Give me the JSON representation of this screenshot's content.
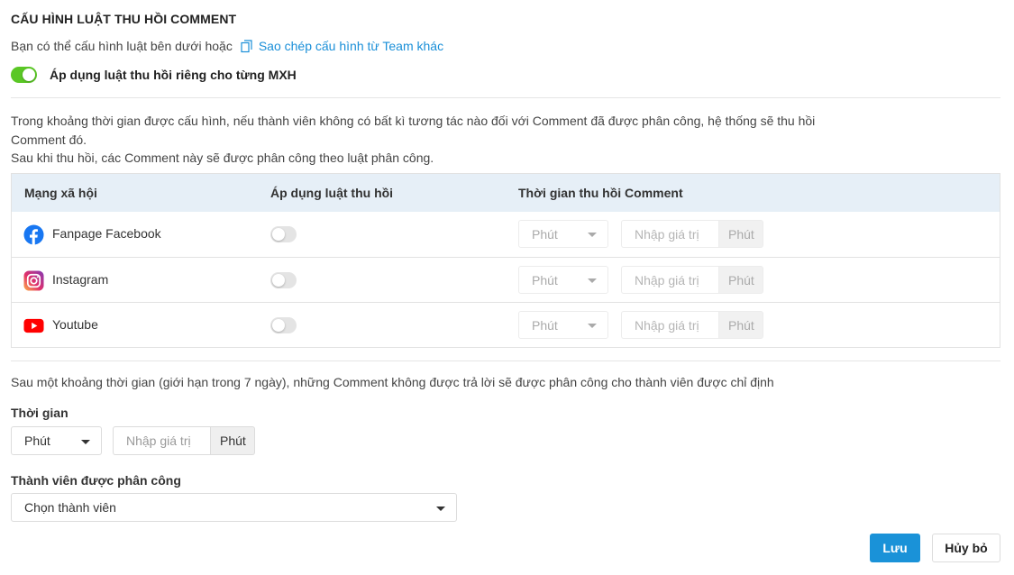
{
  "header": {
    "title": "CẤU HÌNH LUẬT THU HỒI COMMENT",
    "intro_text": "Bạn có thể cấu hình luật bên dưới hoặc",
    "copy_link": "Sao chép cấu hình từ Team khác",
    "copy_icon": "copy-icon"
  },
  "apply_per_network": {
    "label": "Áp dụng luật thu hồi riêng cho từng MXH",
    "enabled": true,
    "accent_color": "#5ac725"
  },
  "description": {
    "line1": "Trong khoảng thời gian được cấu hình, nếu thành viên không có bất kì tương tác nào đối với Comment đã được phân công, hệ thống sẽ thu hồi Comment đó.",
    "line2": "Sau khi thu hồi, các Comment này sẽ được phân công theo luật phân công."
  },
  "table": {
    "columns": [
      "Mạng xã hội",
      "Áp dụng luật thu hồi",
      "Thời gian thu hồi Comment"
    ],
    "rows": [
      {
        "network": "Fanpage Facebook",
        "icon": "facebook-icon",
        "enabled": false,
        "unit": "Phút",
        "placeholder": "Nhập giá trị",
        "addon": "Phút"
      },
      {
        "network": "Instagram",
        "icon": "instagram-icon",
        "enabled": false,
        "unit": "Phút",
        "placeholder": "Nhập giá trị",
        "addon": "Phút"
      },
      {
        "network": "Youtube",
        "icon": "youtube-icon",
        "enabled": false,
        "unit": "Phút",
        "placeholder": "Nhập giá trị",
        "addon": "Phút"
      }
    ]
  },
  "reassign": {
    "text": "Sau một khoảng thời gian (giới hạn trong 7 ngày), những Comment không được trả lời sẽ được phân công cho thành viên được chỉ định",
    "time_label": "Thời gian",
    "unit": "Phút",
    "placeholder": "Nhập giá trị",
    "addon": "Phút",
    "member_label": "Thành viên được phân công",
    "member_select": "Chọn thành viên"
  },
  "actions": {
    "save": "Lưu",
    "cancel": "Hủy bỏ",
    "primary_color": "#1a92d8"
  }
}
